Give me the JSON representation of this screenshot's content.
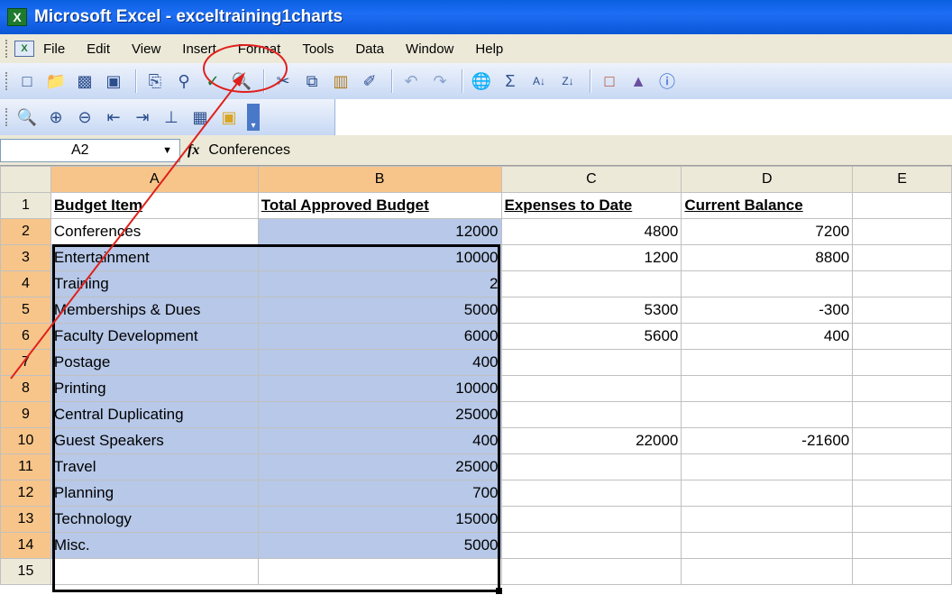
{
  "app": {
    "title": "Microsoft Excel - exceltraining1charts",
    "icon": "excel-icon"
  },
  "menu": {
    "items": [
      {
        "label": "File"
      },
      {
        "label": "Edit"
      },
      {
        "label": "View"
      },
      {
        "label": "Insert"
      },
      {
        "label": "Format"
      },
      {
        "label": "Tools"
      },
      {
        "label": "Data"
      },
      {
        "label": "Window"
      },
      {
        "label": "Help"
      }
    ]
  },
  "toolbar1": {
    "icons": [
      "new-icon",
      "open-icon",
      "save-icon",
      "permission-icon",
      "print-icon",
      "print-preview-icon",
      "spelling-icon",
      "research-icon",
      "cut-icon",
      "copy-icon",
      "paste-icon",
      "format-painter-icon",
      "undo-icon",
      "redo-icon",
      "hyperlink-icon",
      "autosum-icon",
      "sort-ascending-icon",
      "sort-descending-icon",
      "chart-wizard-icon",
      "drawing-icon",
      "help-icon"
    ]
  },
  "toolbar2": {
    "icons": [
      "find-icon",
      "zoom-in-icon",
      "zoom-out-icon",
      "trace-precedents-icon",
      "trace-dependents-icon",
      "organize-icon",
      "form-icon",
      "properties-icon"
    ]
  },
  "formula_bar": {
    "name_box": "A2",
    "fx": "fx",
    "value": "Conferences"
  },
  "sheet": {
    "columns": [
      "A",
      "B",
      "C",
      "D",
      "E"
    ],
    "rows": [
      {
        "n": "1",
        "a": "Budget Item",
        "b": "Total Approved Budget",
        "c": "Expenses to Date",
        "d": "Current Balance"
      },
      {
        "n": "2",
        "a": "Conferences",
        "b": "12000",
        "c": "4800",
        "d": "7200"
      },
      {
        "n": "3",
        "a": "Entertainment",
        "b": "10000",
        "c": "1200",
        "d": "8800"
      },
      {
        "n": "4",
        "a": "Training",
        "b": "2",
        "c": "",
        "d": ""
      },
      {
        "n": "5",
        "a": "Memberships & Dues",
        "b": "5000",
        "c": "5300",
        "d": "-300"
      },
      {
        "n": "6",
        "a": "Faculty Development",
        "b": "6000",
        "c": "5600",
        "d": "400"
      },
      {
        "n": "7",
        "a": "Postage",
        "b": "400",
        "c": "",
        "d": ""
      },
      {
        "n": "8",
        "a": "Printing",
        "b": "10000",
        "c": "",
        "d": ""
      },
      {
        "n": "9",
        "a": "Central Duplicating",
        "b": "25000",
        "c": "",
        "d": ""
      },
      {
        "n": "10",
        "a": "Guest Speakers",
        "b": "400",
        "c": "22000",
        "d": "-21600"
      },
      {
        "n": "11",
        "a": "Travel",
        "b": "25000",
        "c": "",
        "d": ""
      },
      {
        "n": "12",
        "a": "Planning",
        "b": "700",
        "c": "",
        "d": ""
      },
      {
        "n": "13",
        "a": "Technology",
        "b": "15000",
        "c": "",
        "d": ""
      },
      {
        "n": "14",
        "a": "Misc.",
        "b": "5000",
        "c": "",
        "d": ""
      },
      {
        "n": "15",
        "a": "",
        "b": "",
        "c": "",
        "d": ""
      }
    ]
  },
  "colors": {
    "selection": "#b7c8e8",
    "header_highlight": "#f7c58a",
    "annotation": "#e0201c"
  }
}
